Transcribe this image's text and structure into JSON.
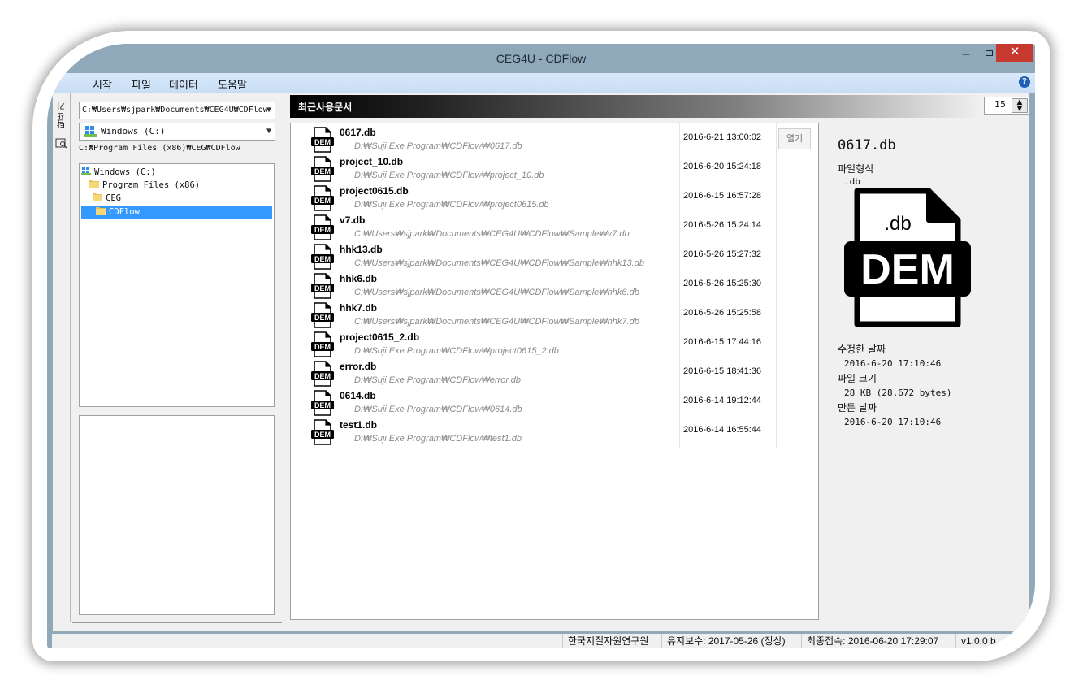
{
  "window": {
    "title": "CEG4U - CDFlow",
    "minimize_label": "–",
    "close_label": "✕"
  },
  "menu": {
    "items": [
      "시작",
      "파일",
      "데이터",
      "도움말"
    ],
    "help_label": "?"
  },
  "side_tab": {
    "label": "탐색기",
    "icon": "folder-search-icon"
  },
  "explorer": {
    "path_value": "C:₩Users₩sjpark₩Documents₩CEG4U₩CDFlow",
    "drive_value": "Windows (C:)",
    "current_path": "C:₩Program Files (x86)₩CEG₩CDFlow",
    "tree": [
      {
        "label": "Windows (C:)",
        "icon": "drive-icon",
        "selected": false
      },
      {
        "label": "Program Files (x86)",
        "icon": "folder-icon",
        "selected": false
      },
      {
        "label": "CEG",
        "icon": "folder-icon",
        "selected": false
      },
      {
        "label": "CDFlow",
        "icon": "folder-icon",
        "selected": true
      }
    ]
  },
  "recent": {
    "title": "최근사용문서",
    "count": "15",
    "open_label": "열기",
    "items": [
      {
        "name": "0617.db",
        "path": "D:₩Suji Exe Program₩CDFlow₩0617.db",
        "date": "2016-6-21 13:00:02"
      },
      {
        "name": "project_10.db",
        "path": "D:₩Suji Exe Program₩CDFlow₩project_10.db",
        "date": "2016-6-20 15:24:18"
      },
      {
        "name": "project0615.db",
        "path": "D:₩Suji Exe Program₩CDFlow₩project0615.db",
        "date": "2016-6-15 16:57:28"
      },
      {
        "name": "v7.db",
        "path": "C:₩Users₩sjpark₩Documents₩CEG4U₩CDFlow₩Sample₩v7.db",
        "date": "2016-5-26 15:24:14"
      },
      {
        "name": "hhk13.db",
        "path": "C:₩Users₩sjpark₩Documents₩CEG4U₩CDFlow₩Sample₩hhk13.db",
        "date": "2016-5-26 15:27:32"
      },
      {
        "name": "hhk6.db",
        "path": "C:₩Users₩sjpark₩Documents₩CEG4U₩CDFlow₩Sample₩hhk6.db",
        "date": "2016-5-26 15:25:30"
      },
      {
        "name": "hhk7.db",
        "path": "C:₩Users₩sjpark₩Documents₩CEG4U₩CDFlow₩Sample₩hhk7.db",
        "date": "2016-5-26 15:25:58"
      },
      {
        "name": "project0615_2.db",
        "path": "D:₩Suji Exe Program₩CDFlow₩project0615_2.db",
        "date": "2016-6-15 17:44:16"
      },
      {
        "name": "error.db",
        "path": "D:₩Suji Exe Program₩CDFlow₩error.db",
        "date": "2016-6-15 18:41:36"
      },
      {
        "name": "0614.db",
        "path": "D:₩Suji Exe Program₩CDFlow₩0614.db",
        "date": "2016-6-14 19:12:44"
      },
      {
        "name": "test1.db",
        "path": "D:₩Suji Exe Program₩CDFlow₩test1.db",
        "date": "2016-6-14 16:55:44"
      }
    ]
  },
  "details": {
    "file_name": "0617.db",
    "format_label": "파일형식",
    "format_value": ".db",
    "icon_ext": ".db",
    "icon_text": "DEM",
    "modified_label": "수정한 날짜",
    "modified_value": "2016-6-20 17:10:46",
    "size_label": "파일 크기",
    "size_value": "28 KB (28,672 bytes)",
    "created_label": "만든 날짜",
    "created_value": "2016-6-20 17:10:46"
  },
  "status": {
    "org": "한국지질자원연구원",
    "maintenance": "유지보수: 2017-05-26 (정상)",
    "last_access": "최종접속: 2016-06-20 17:29:07",
    "version": "v1.0.0 b"
  },
  "colors": {
    "titlebar": "#8fa9ba",
    "close_button": "#c7382e",
    "selection": "#3399ff",
    "menubar": "#d9e9fb"
  }
}
